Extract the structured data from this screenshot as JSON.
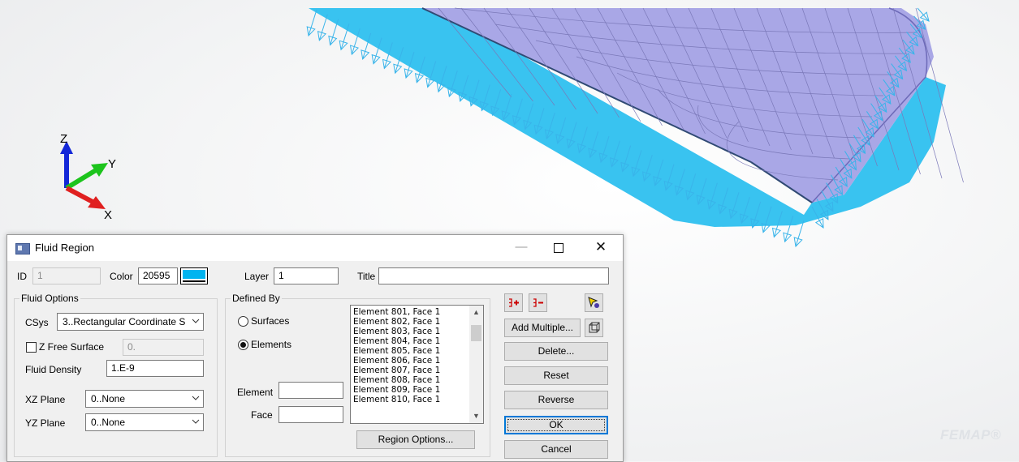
{
  "viewport": {
    "watermark": "FEMAP®",
    "axes": {
      "z": "Z",
      "y": "Y",
      "x": "X"
    },
    "colors": {
      "load_arrow": "#39b4ea",
      "mesh_face": "#a9a7e6",
      "mesh_side": "#2ec0ef"
    }
  },
  "dialog": {
    "title": "Fluid Region",
    "titlebar_buttons": {
      "minimize": "—",
      "maximize": "□",
      "close": "✕"
    },
    "id_label": "ID",
    "id_value": "1",
    "color_label": "Color",
    "color_value": "20595",
    "color_swatch": "#00b4f0",
    "layer_label": "Layer",
    "layer_value": "1",
    "title_label": "Title",
    "title_value": "",
    "fluid_options": {
      "caption": "Fluid Options",
      "csys_label": "CSys",
      "csys_value": "3..Rectangular Coordinate S",
      "z_free_surface_label": "Z Free Surface",
      "z_free_surface_checked": false,
      "z_free_surface_value": "0.",
      "fluid_density_label": "Fluid Density",
      "fluid_density_value": "1.E-9",
      "xz_plane_label": "XZ Plane",
      "xz_plane_value": "0..None",
      "yz_plane_label": "YZ Plane",
      "yz_plane_value": "0..None"
    },
    "defined_by": {
      "caption": "Defined By",
      "surfaces_label": "Surfaces",
      "elements_label": "Elements",
      "selected": "Elements",
      "element_label": "Element",
      "element_value": "",
      "face_label": "Face",
      "face_value": "",
      "list_items": [
        "Element 801, Face 1",
        "Element 802, Face 1",
        "Element 803, Face 1",
        "Element 804, Face 1",
        "Element 805, Face 1",
        "Element 806, Face 1",
        "Element 807, Face 1",
        "Element 808, Face 1",
        "Element 809, Face 1",
        "Element 810, Face 1"
      ],
      "region_options_label": "Region Options..."
    },
    "buttons": {
      "add_multiple": "Add Multiple...",
      "delete": "Delete...",
      "reset": "Reset",
      "reverse": "Reverse",
      "ok": "OK",
      "cancel": "Cancel"
    }
  }
}
